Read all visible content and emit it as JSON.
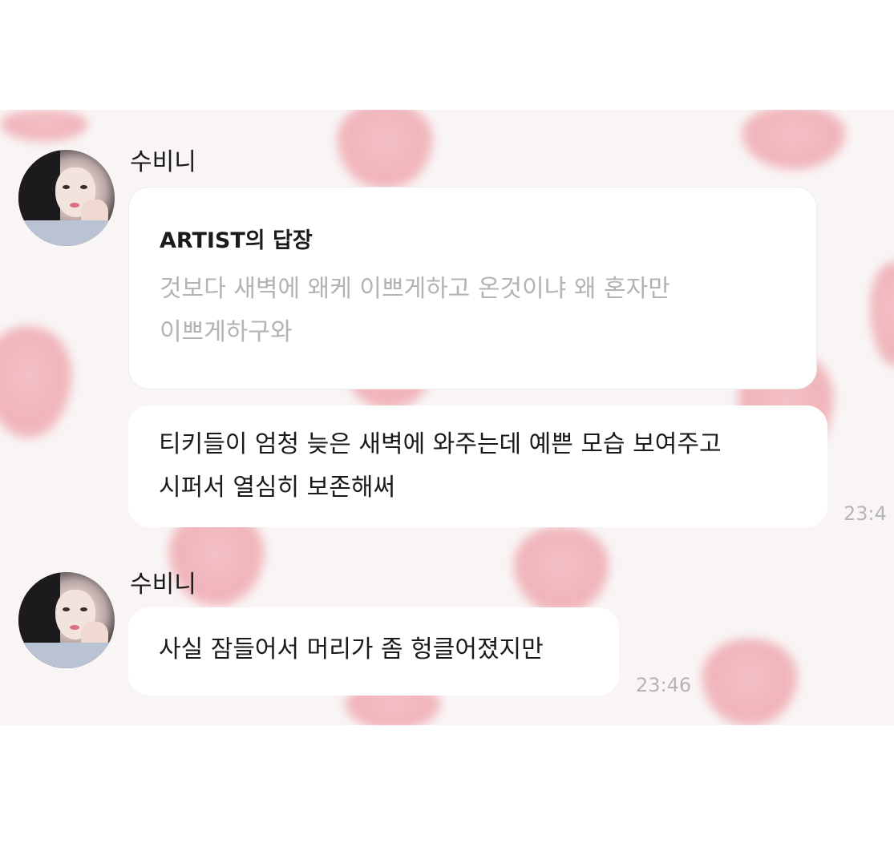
{
  "colors": {
    "background": "#f9f5f5",
    "strawberry": "#efaab1",
    "bubble": "#ffffff",
    "text": "#1a1a1a",
    "quote_text": "#b3b3b3",
    "timestamp": "#b5b5b5"
  },
  "messages": [
    {
      "sender": "수비니",
      "reply": {
        "title": "ARTIST의 답장",
        "quote_line1": "것보다 새벽에 왜케 이쁘게하고 온것이냐 왜 혼자만",
        "quote_line2": "이쁘게하구와"
      },
      "text_line1": "티키들이 엄청 늦은 새벽에 와주는데 예쁜 모습 보여주고",
      "text_line2": "시퍼서 열심히 보존해써",
      "time": "23:4"
    },
    {
      "sender": "수비니",
      "text_line1": "사실 잠들어서 머리가 좀 헝클어졌지만",
      "time": "23:46"
    }
  ]
}
